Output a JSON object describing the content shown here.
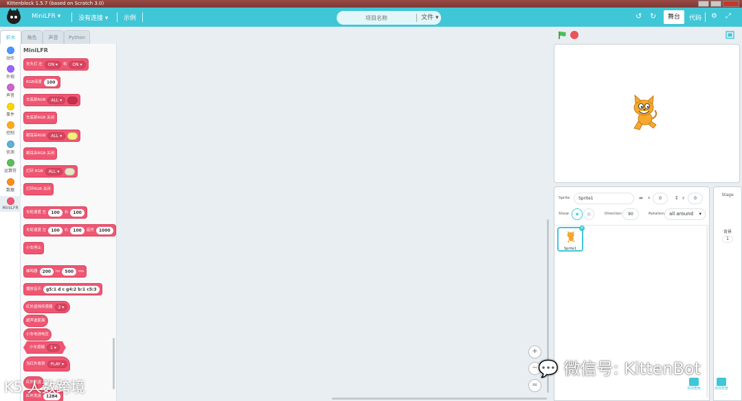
{
  "window": {
    "title": "Kittenblock 1.5.7 (based on Scratch 3.0)"
  },
  "menubar": {
    "device": "MiniLFR ▾",
    "connection": "没有连接 ▾",
    "examples": "示例",
    "project_placeholder": "项目名称",
    "file": "文件 ▾",
    "stage": "舞台",
    "code": "代码"
  },
  "tabs": [
    "积木",
    "角色",
    "声音",
    "Python"
  ],
  "categories": [
    {
      "label": "动作",
      "color": "#4c97ff"
    },
    {
      "label": "外观",
      "color": "#9966ff"
    },
    {
      "label": "声音",
      "color": "#cf63cf"
    },
    {
      "label": "事件",
      "color": "#ffd500"
    },
    {
      "label": "控制",
      "color": "#ffab19"
    },
    {
      "label": "侦测",
      "color": "#5cb1d6"
    },
    {
      "label": "运算符",
      "color": "#59c059"
    },
    {
      "label": "数据",
      "color": "#ff8c1a"
    },
    {
      "label": "MiniLFR",
      "color": "#ef5672"
    }
  ],
  "palette": {
    "title": "MiniLFR",
    "blocks": [
      {
        "text": "车头灯 左",
        "d1": "ON",
        "t2": "右",
        "d2": "ON"
      },
      {
        "text": "RGB亮度",
        "p1": "100"
      },
      {
        "text": "车底部RGB",
        "d1": "ALL",
        "swatch": "#c8304a"
      },
      {
        "text": "车底部RGB 关闭"
      },
      {
        "text": "眼耳朵RGB",
        "d1": "ALL",
        "swatch": "#f2f27a"
      },
      {
        "text": "眼耳朵RGB 关闭"
      },
      {
        "text": "灯环 RGB",
        "d1": "ALL",
        "swatch": "#e4e8c8"
      },
      {
        "text": "灯环RGB 关闭"
      },
      {
        "text": "车轮速度 左",
        "p1": "100",
        "t2": "右",
        "p2": "100"
      },
      {
        "text": "车轮速度 左",
        "p1": "100",
        "t2": "右",
        "p2": "100",
        "t3": "延时",
        "p3": "1000"
      },
      {
        "text": "小车停止"
      },
      {
        "text": "蜂鸣器",
        "p1": "200",
        "t2": "hz",
        "p2": "500",
        "t3": "ms"
      },
      {
        "text": "播放音乐",
        "p1": "g5:1 d c g4:2 b:1 c5:3"
      },
      {
        "text": "红外巡线传感器",
        "d1": "2"
      },
      {
        "text": "超声波距离"
      },
      {
        "text": "小车电池电压"
      },
      {
        "text": "小车按键",
        "d1": "1"
      },
      {
        "text": "当红外收到",
        "d1": "PLAY"
      },
      {
        "text": "红外发送"
      },
      {
        "text": "红外发送",
        "p1": "1284"
      }
    ]
  },
  "sprite_info": {
    "sprite_label": "Sprite",
    "sprite_name": "Sprite1",
    "x_label": "x",
    "x": "0",
    "y_label": "y",
    "y": "0",
    "show_label": "Show",
    "direction_label": "Direction",
    "direction": "90",
    "rotation_label": "Rotation",
    "rotation": "all around",
    "sprite_card_name": "Sprite1"
  },
  "stage_panel": {
    "title": "Stage",
    "backdrops_label": "背景",
    "backdrops_count": "1"
  },
  "bottom": {
    "add_sprite": "添加角色",
    "add_backdrop": "添加背景"
  },
  "zoom": {
    "in": "+",
    "out": "−",
    "reset": "="
  },
  "watermark": "微信号: KittenBot",
  "corner_logo": "K5 人数跨境"
}
